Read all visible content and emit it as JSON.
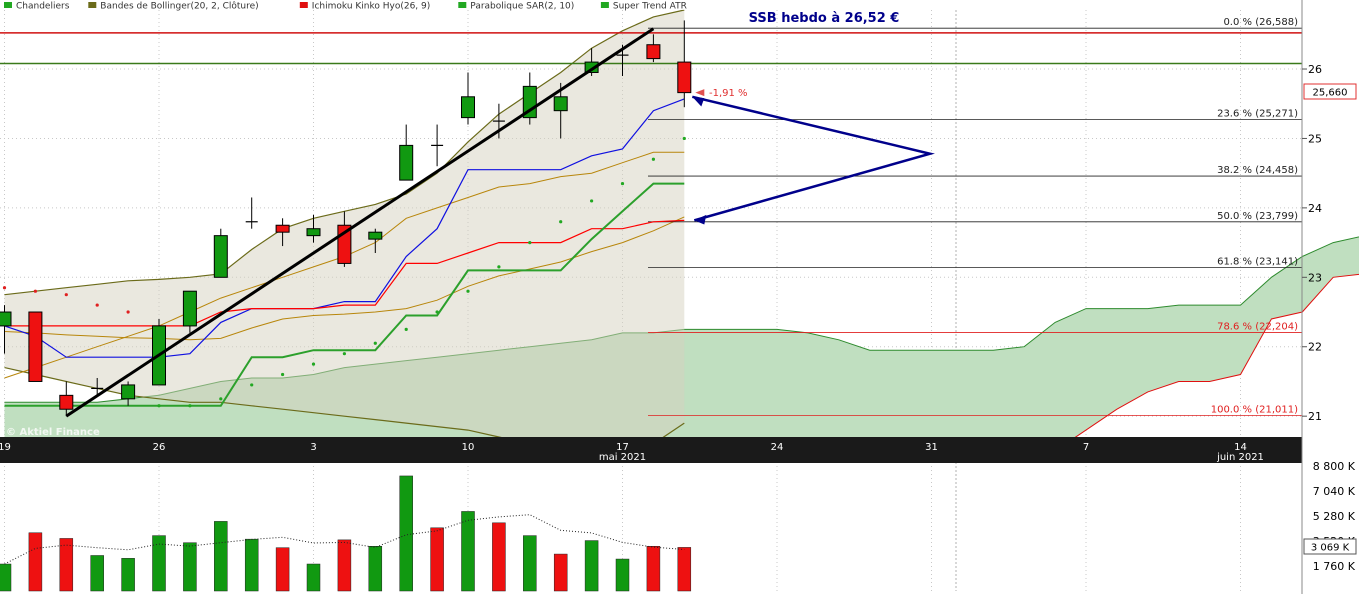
{
  "legend": {
    "items": [
      {
        "label": "Chandeliers",
        "color": "#22a822"
      },
      {
        "label": "Bandes de Bollinger(20, 2, Clôture)",
        "color": "#6b6b1a"
      },
      {
        "label": "Ichimoku Kinko Hyo(26, 9)",
        "color": "#e01010"
      },
      {
        "label": "Parabolique SAR(2, 10)",
        "color": "#22a822"
      },
      {
        "label": "Super Trend ATR",
        "color": "#22a822"
      }
    ]
  },
  "annotation": {
    "title": "SSB hebdo à 26,52 €",
    "change": "-1,91 %"
  },
  "watermark": "© Aktiel Finance",
  "price_label": "25,660",
  "volume_label": "3 069 K",
  "colors": {
    "up": "#119911",
    "down": "#ee1111",
    "bollinger": "#6b6b1a",
    "kijun": "#2ca02c",
    "tenkan": "#ff0000",
    "arrow": "#00008b",
    "cloud_fill": "#c0dfc0",
    "lead_dark": "#b8860b"
  },
  "chart_data": {
    "type": "candlestick",
    "x_ticks": [
      {
        "label": "19"
      },
      {
        "label": "26"
      },
      {
        "label": "3"
      },
      {
        "label": "10"
      },
      {
        "label": "17",
        "sub": "mai 2021"
      },
      {
        "label": "24"
      },
      {
        "label": "31"
      },
      {
        "label": "7"
      },
      {
        "label": "14",
        "sub": "juin 2021"
      }
    ],
    "y_ticks": [
      "21",
      "22",
      "23",
      "24",
      "25",
      "26"
    ],
    "ylim": [
      20.7,
      26.85
    ],
    "candles": [
      {
        "date": "2021-04-19",
        "o": 22.3,
        "h": 22.6,
        "l": 21.9,
        "c": 22.5
      },
      {
        "date": "2021-04-20",
        "o": 22.5,
        "h": 22.5,
        "l": 21.5,
        "c": 21.5
      },
      {
        "date": "2021-04-21",
        "o": 21.3,
        "h": 21.5,
        "l": 21.0,
        "c": 21.1
      },
      {
        "date": "2021-04-22",
        "o": 21.4,
        "h": 21.55,
        "l": 21.3,
        "c": 21.4
      },
      {
        "date": "2021-04-23",
        "o": 21.25,
        "h": 21.5,
        "l": 21.15,
        "c": 21.45
      },
      {
        "date": "2021-04-26",
        "o": 21.45,
        "h": 22.4,
        "l": 21.45,
        "c": 22.3
      },
      {
        "date": "2021-04-27",
        "o": 22.3,
        "h": 22.8,
        "l": 22.2,
        "c": 22.8
      },
      {
        "date": "2021-04-28",
        "o": 23.0,
        "h": 23.7,
        "l": 23.0,
        "c": 23.6
      },
      {
        "date": "2021-04-29",
        "o": 23.8,
        "h": 24.15,
        "l": 23.7,
        "c": 23.8
      },
      {
        "date": "2021-04-30",
        "o": 23.75,
        "h": 23.85,
        "l": 23.45,
        "c": 23.65
      },
      {
        "date": "2021-05-03",
        "o": 23.6,
        "h": 23.9,
        "l": 23.5,
        "c": 23.7
      },
      {
        "date": "2021-05-04",
        "o": 23.75,
        "h": 23.95,
        "l": 23.15,
        "c": 23.2
      },
      {
        "date": "2021-05-05",
        "o": 23.55,
        "h": 23.7,
        "l": 23.35,
        "c": 23.65
      },
      {
        "date": "2021-05-06",
        "o": 24.4,
        "h": 25.2,
        "l": 24.4,
        "c": 24.9
      },
      {
        "date": "2021-05-07",
        "o": 24.9,
        "h": 25.2,
        "l": 24.6,
        "c": 24.9
      },
      {
        "date": "2021-05-10",
        "o": 25.3,
        "h": 25.95,
        "l": 25.2,
        "c": 25.6
      },
      {
        "date": "2021-05-11",
        "o": 25.25,
        "h": 25.5,
        "l": 25.0,
        "c": 25.2
      },
      {
        "date": "2021-05-12",
        "o": 25.3,
        "h": 25.95,
        "l": 25.2,
        "c": 25.75
      },
      {
        "date": "2021-05-13",
        "o": 25.4,
        "h": 25.8,
        "l": 25.0,
        "c": 25.6
      },
      {
        "date": "2021-05-14",
        "o": 25.95,
        "h": 26.3,
        "l": 25.9,
        "c": 26.1
      },
      {
        "date": "2021-05-17",
        "o": 26.2,
        "h": 26.35,
        "l": 25.9,
        "c": 26.2
      },
      {
        "date": "2021-05-18",
        "o": 26.35,
        "h": 26.5,
        "l": 26.1,
        "c": 26.15
      },
      {
        "date": "2021-05-19",
        "o": 26.1,
        "h": 26.7,
        "l": 25.45,
        "c": 25.66
      }
    ],
    "volume_ticks": [
      "1 760 K",
      "3 520 K",
      "5 280 K",
      "7 040 K",
      "8 800 K"
    ],
    "volume_max": 8800,
    "volumes": [
      {
        "v": 1900,
        "up": true
      },
      {
        "v": 4100,
        "up": false
      },
      {
        "v": 3700,
        "up": false
      },
      {
        "v": 2500,
        "up": true
      },
      {
        "v": 2300,
        "up": true
      },
      {
        "v": 3900,
        "up": true
      },
      {
        "v": 3400,
        "up": true
      },
      {
        "v": 4900,
        "up": true
      },
      {
        "v": 3650,
        "up": true
      },
      {
        "v": 3050,
        "up": false
      },
      {
        "v": 1900,
        "up": true
      },
      {
        "v": 3600,
        "up": false
      },
      {
        "v": 3150,
        "up": true
      },
      {
        "v": 8100,
        "up": true
      },
      {
        "v": 4450,
        "up": false
      },
      {
        "v": 5600,
        "up": true
      },
      {
        "v": 4800,
        "up": false
      },
      {
        "v": 3900,
        "up": true
      },
      {
        "v": 2600,
        "up": false
      },
      {
        "v": 3550,
        "up": true
      },
      {
        "v": 2250,
        "up": true
      },
      {
        "v": 3150,
        "up": false
      },
      {
        "v": 3069,
        "up": false
      }
    ],
    "fibonacci": [
      {
        "label": "0.0 % (26,588)",
        "v": 26.588
      },
      {
        "label": "23.6 % (25,271)",
        "v": 25.271
      },
      {
        "label": "38.2 % (24,458)",
        "v": 24.458
      },
      {
        "label": "50.0 % (23,799)",
        "v": 23.799
      },
      {
        "label": "61.8 % (23,141)",
        "v": 23.141
      },
      {
        "label": "78.6 % (22,204)",
        "v": 22.204
      },
      {
        "label": "100.0 % (21,011)",
        "v": 21.011
      }
    ],
    "horizontal_levels": [
      {
        "v": 26.52,
        "color": "#d01010"
      },
      {
        "v": 26.08,
        "color": "#3a7a1a"
      }
    ],
    "bollinger_upper": [
      22.75,
      22.8,
      22.85,
      22.9,
      22.95,
      22.97,
      23.0,
      23.05,
      23.4,
      23.7,
      23.85,
      23.95,
      24.05,
      24.2,
      24.5,
      24.95,
      25.35,
      25.65,
      25.95,
      26.3,
      26.55,
      26.75,
      26.85
    ],
    "bollinger_lower": [
      21.7,
      21.6,
      21.5,
      21.4,
      21.3,
      21.25,
      21.2,
      21.2,
      21.15,
      21.1,
      21.05,
      21.0,
      20.95,
      20.9,
      20.85,
      20.8,
      20.7,
      20.6,
      20.5,
      20.45,
      20.45,
      20.6,
      20.9
    ],
    "bollinger_mid": [
      22.22,
      22.2,
      22.17,
      22.15,
      22.13,
      22.12,
      22.1,
      22.12,
      22.27,
      22.4,
      22.45,
      22.47,
      22.5,
      22.55,
      22.67,
      22.87,
      23.02,
      23.12,
      23.22,
      23.37,
      23.5,
      23.67,
      23.87
    ],
    "tenkan": [
      22.3,
      22.3,
      22.3,
      22.3,
      22.3,
      22.3,
      22.3,
      22.5,
      22.55,
      22.55,
      22.55,
      22.6,
      22.6,
      23.2,
      23.2,
      23.35,
      23.5,
      23.5,
      23.5,
      23.7,
      23.7,
      23.8,
      23.82
    ],
    "kijun": [
      21.15,
      21.15,
      21.15,
      21.15,
      21.15,
      21.15,
      21.15,
      21.15,
      21.85,
      21.85,
      21.95,
      21.95,
      21.95,
      22.45,
      22.45,
      23.1,
      23.1,
      23.1,
      23.1,
      23.55,
      23.95,
      24.35,
      24.35
    ],
    "blue_line": [
      22.3,
      22.15,
      21.85,
      21.85,
      21.85,
      21.85,
      21.9,
      22.35,
      22.55,
      22.55,
      22.55,
      22.65,
      22.65,
      23.3,
      23.7,
      24.55,
      24.55,
      24.55,
      24.55,
      24.75,
      24.85,
      25.4,
      25.57
    ],
    "sar": [
      22.85,
      22.8,
      22.75,
      22.6,
      22.5,
      21.15,
      21.15,
      21.25,
      21.45,
      21.6,
      21.75,
      21.9,
      22.05,
      22.25,
      22.5,
      22.8,
      23.15,
      23.5,
      23.8,
      24.1,
      24.35,
      24.7,
      25.0
    ],
    "cloud_span_a": [
      21.2,
      21.2,
      21.2,
      21.2,
      21.25,
      21.3,
      21.4,
      21.5,
      21.55,
      21.55,
      21.6,
      21.7,
      21.75,
      21.8,
      21.85,
      21.9,
      21.95,
      22.0,
      22.05,
      22.1,
      22.2,
      22.2,
      22.25,
      22.25,
      22.25,
      22.25,
      22.2,
      22.1,
      21.95,
      21.95,
      21.95,
      21.95,
      21.95,
      22.0,
      22.35,
      22.55,
      22.55,
      22.55,
      22.6,
      22.6,
      22.6,
      23.0,
      23.3,
      23.5,
      23.6,
      24.0,
      24.05
    ],
    "cloud_span_b": [
      20.4,
      20.4,
      20.4,
      20.4,
      20.4,
      20.4,
      20.4,
      20.4,
      20.4,
      20.4,
      20.4,
      20.4,
      20.4,
      20.4,
      20.4,
      20.4,
      20.4,
      20.4,
      20.4,
      20.4,
      20.4,
      20.4,
      20.4,
      20.4,
      20.4,
      20.4,
      20.4,
      20.4,
      20.4,
      20.4,
      20.4,
      20.4,
      20.4,
      20.4,
      20.5,
      20.8,
      21.1,
      21.35,
      21.5,
      21.5,
      21.6,
      22.4,
      22.5,
      23.0,
      23.05,
      23.05,
      23.05
    ],
    "lagging": [
      21.55,
      21.7,
      21.85,
      22.0,
      22.15,
      22.3,
      22.5,
      22.7,
      22.85,
      23.0,
      23.15,
      23.3,
      23.5,
      23.85,
      24.0,
      24.15,
      24.3,
      24.35,
      24.45,
      24.5,
      24.65,
      24.8,
      24.8
    ]
  }
}
